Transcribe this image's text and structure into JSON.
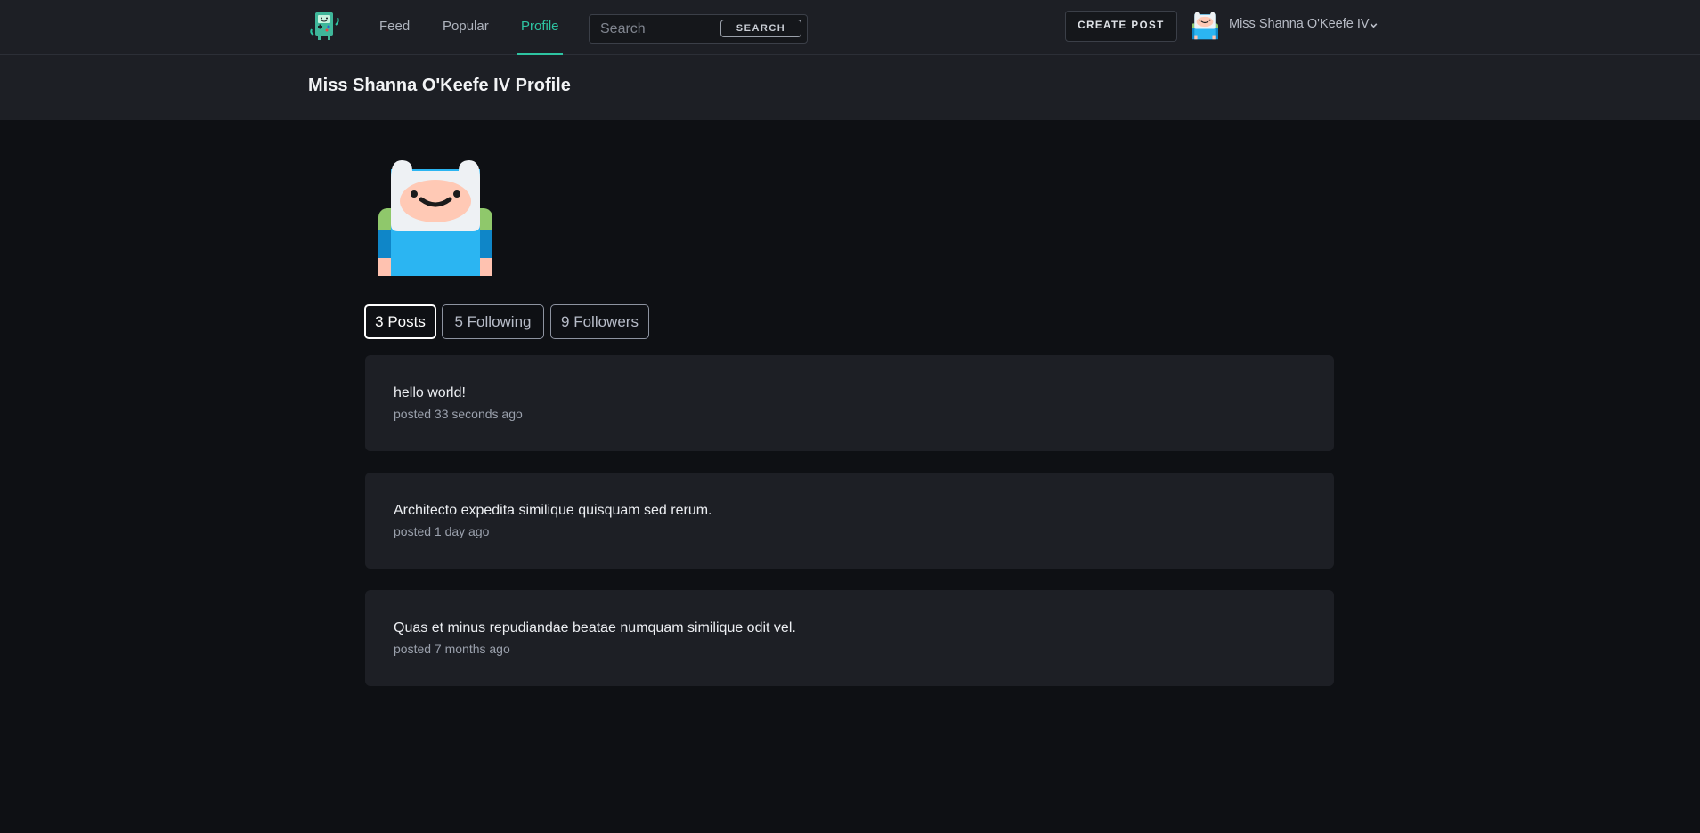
{
  "nav": {
    "links": [
      {
        "label": "Feed"
      },
      {
        "label": "Popular"
      },
      {
        "label": "Profile",
        "active": true
      }
    ],
    "search": {
      "placeholder": "Search",
      "button_label": "SEARCH"
    },
    "create_post_label": "CREATE POST",
    "user": {
      "name": "Miss Shanna O'Keefe IV",
      "avatar_icon": "finn-avatar-icon"
    }
  },
  "header": {
    "title": "Miss Shanna O'Keefe IV Profile"
  },
  "profile": {
    "avatar_icon": "finn-avatar-icon",
    "tabs": [
      {
        "label": "3 Posts",
        "active": true
      },
      {
        "label": "5 Following"
      },
      {
        "label": "9 Followers"
      }
    ]
  },
  "posts": [
    {
      "body": "hello world!",
      "time": "posted 33 seconds ago"
    },
    {
      "body": "Architecto expedita similique quisquam sed rerum.",
      "time": "posted 1 day ago"
    },
    {
      "body": "Quas et minus repudiandae beatae numquam similique odit vel.",
      "time": "posted 7 months ago"
    }
  ],
  "colors": {
    "accent": "#2ec4a2",
    "background": "#0e1014",
    "panel": "#1d1f25"
  }
}
